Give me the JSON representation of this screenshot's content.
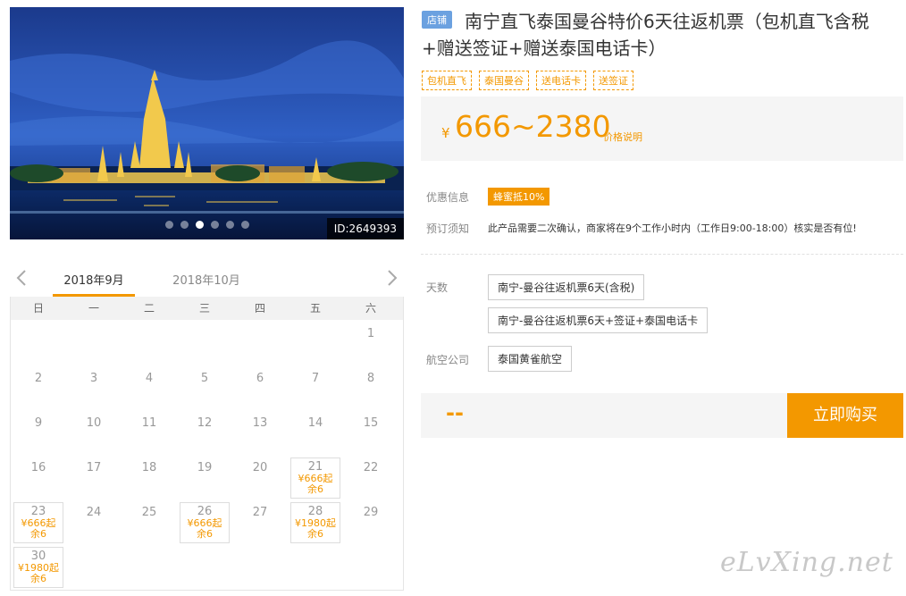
{
  "gallery": {
    "image": "bangkok-wat-arun-night",
    "dots": [
      false,
      false,
      true,
      false,
      false,
      false
    ],
    "id_label": "ID:2649393"
  },
  "product": {
    "shop_tag": "店铺",
    "title": "南宁直飞泰国曼谷特价6天往返机票（包机直飞含税+赠送签证+赠送泰国电话卡）",
    "tags": [
      "包机直飞",
      "泰国曼谷",
      "送电话卡",
      "送签证"
    ],
    "price_symbol": "¥",
    "price_range": "666~2380",
    "price_note": "价格说明",
    "discount_label": "优惠信息",
    "discount_badge": "蜂蜜抵10%",
    "booking_label": "预订须知",
    "booking_text": "此产品需要二次确认，商家将在9个工作小时内（工作日9:00-18:00）核实是否有位!",
    "days_label": "天数",
    "day_options": [
      "南宁-曼谷往返机票6天(含税)",
      "南宁-曼谷往返机票6天+签证+泰国电话卡"
    ],
    "airline_label": "航空公司",
    "airline_options": [
      "泰国黄雀航空"
    ],
    "selected_price": "--",
    "buy_button": "立即购买"
  },
  "calendar": {
    "tabs": [
      "2018年9月",
      "2018年10月"
    ],
    "weekdays": [
      "日",
      "一",
      "二",
      "三",
      "四",
      "五",
      "六"
    ],
    "leading_blanks": 6,
    "days": [
      {
        "d": "1"
      },
      {
        "d": "2"
      },
      {
        "d": "3"
      },
      {
        "d": "4"
      },
      {
        "d": "5"
      },
      {
        "d": "6"
      },
      {
        "d": "7"
      },
      {
        "d": "8"
      },
      {
        "d": "9"
      },
      {
        "d": "10"
      },
      {
        "d": "11"
      },
      {
        "d": "12"
      },
      {
        "d": "13"
      },
      {
        "d": "14"
      },
      {
        "d": "15"
      },
      {
        "d": "16"
      },
      {
        "d": "17"
      },
      {
        "d": "18"
      },
      {
        "d": "19"
      },
      {
        "d": "20"
      },
      {
        "d": "21",
        "price": "¥666起",
        "left": "余6"
      },
      {
        "d": "22"
      },
      {
        "d": "23",
        "price": "¥666起",
        "left": "余6"
      },
      {
        "d": "24"
      },
      {
        "d": "25"
      },
      {
        "d": "26",
        "price": "¥666起",
        "left": "余6"
      },
      {
        "d": "27"
      },
      {
        "d": "28",
        "price": "¥1980起",
        "left": "余6"
      },
      {
        "d": "29"
      },
      {
        "d": "30",
        "price": "¥1980起",
        "left": "余6"
      }
    ]
  },
  "watermark": "eLvXing.net"
}
